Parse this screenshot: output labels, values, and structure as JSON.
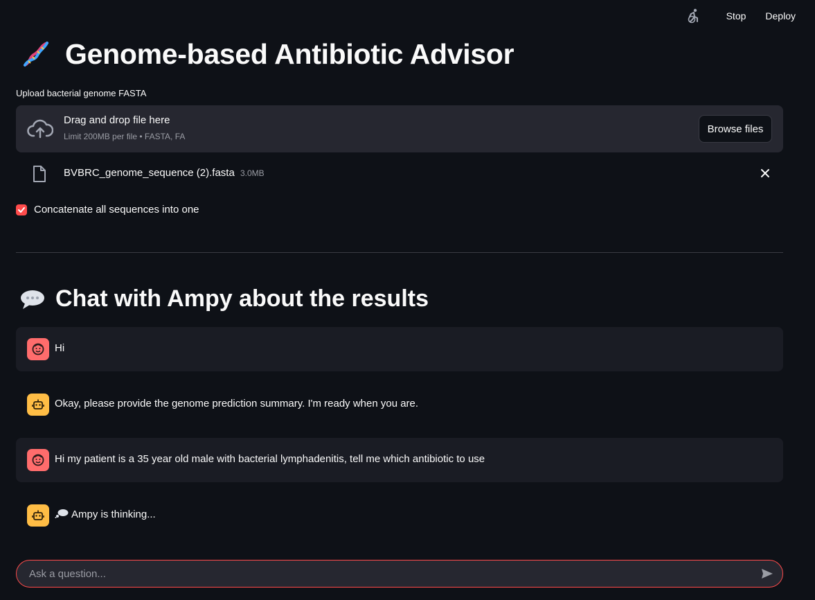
{
  "topbar": {
    "stop_label": "Stop",
    "deploy_label": "Deploy",
    "running_icon": "running-man-icon"
  },
  "app": {
    "title": "Genome-based Antibiotic Advisor",
    "title_icon": "dna-icon"
  },
  "uploader": {
    "label": "Upload bacterial genome FASTA",
    "drop_title": "Drag and drop file here",
    "drop_sub": "Limit 200MB per file • FASTA, FA",
    "browse_label": "Browse files",
    "file": {
      "name": "BVBRC_genome_sequence (2).fasta",
      "size": "3.0MB"
    }
  },
  "options": {
    "concatenate_label": "Concatenate all sequences into one",
    "concatenate_checked": true
  },
  "chat": {
    "title": "Chat with Ampy about the results",
    "messages": [
      {
        "role": "user",
        "text": "Hi"
      },
      {
        "role": "assistant",
        "text": "Okay, please provide the genome prediction summary. I'm ready when you are."
      },
      {
        "role": "user",
        "text": "Hi my patient is a 35 year old male with bacterial lymphadenitis, tell me which antibiotic to use"
      },
      {
        "role": "assistant",
        "text": "Ampy is thinking..."
      }
    ],
    "input_placeholder": "Ask a question...",
    "input_value": ""
  },
  "colors": {
    "background": "#0e1117",
    "accent": "#ff4b4b",
    "user_avatar": "#ff6c6c",
    "bot_avatar": "#ffbd45"
  }
}
